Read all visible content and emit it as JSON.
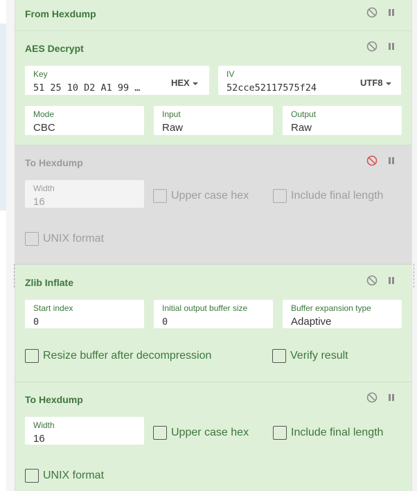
{
  "recipe": {
    "from_hexdump": {
      "title": "From Hexdump"
    },
    "aes_decrypt": {
      "title": "AES Decrypt",
      "key": {
        "label": "Key",
        "value": "51 25 10 D2 A1 99 …",
        "encoding": "HEX"
      },
      "iv": {
        "label": "IV",
        "value": "52cce52117575f24",
        "encoding": "UTF8"
      },
      "mode": {
        "label": "Mode",
        "value": "CBC"
      },
      "input": {
        "label": "Input",
        "value": "Raw"
      },
      "output": {
        "label": "Output",
        "value": "Raw"
      }
    },
    "to_hexdump_disabled": {
      "title": "To Hexdump",
      "width": {
        "label": "Width",
        "value": "16"
      },
      "upper_case_hex": "Upper case hex",
      "include_final_length": "Include final length",
      "unix_format": "UNIX format"
    },
    "zlib_inflate": {
      "title": "Zlib Inflate",
      "start_index": {
        "label": "Start index",
        "value": "0"
      },
      "initial_output_buffer_size": {
        "label": "Initial output buffer size",
        "value": "0"
      },
      "buffer_expansion_type": {
        "label": "Buffer expansion type",
        "value": "Adaptive"
      },
      "resize_buffer": "Resize buffer after decompression",
      "verify_result": "Verify result"
    },
    "to_hexdump": {
      "title": "To Hexdump",
      "width": {
        "label": "Width",
        "value": "16"
      },
      "upper_case_hex": "Upper case hex",
      "include_final_length": "Include final length",
      "unix_format": "UNIX format"
    }
  },
  "colors": {
    "enabled_bg": "#dff0d8",
    "disabled_bg": "#dedede",
    "title_green": "#3c763d",
    "disable_icon_active": "#d9534f"
  },
  "icons": {
    "disable": "disable-icon",
    "breakpoint": "pause-icon"
  }
}
